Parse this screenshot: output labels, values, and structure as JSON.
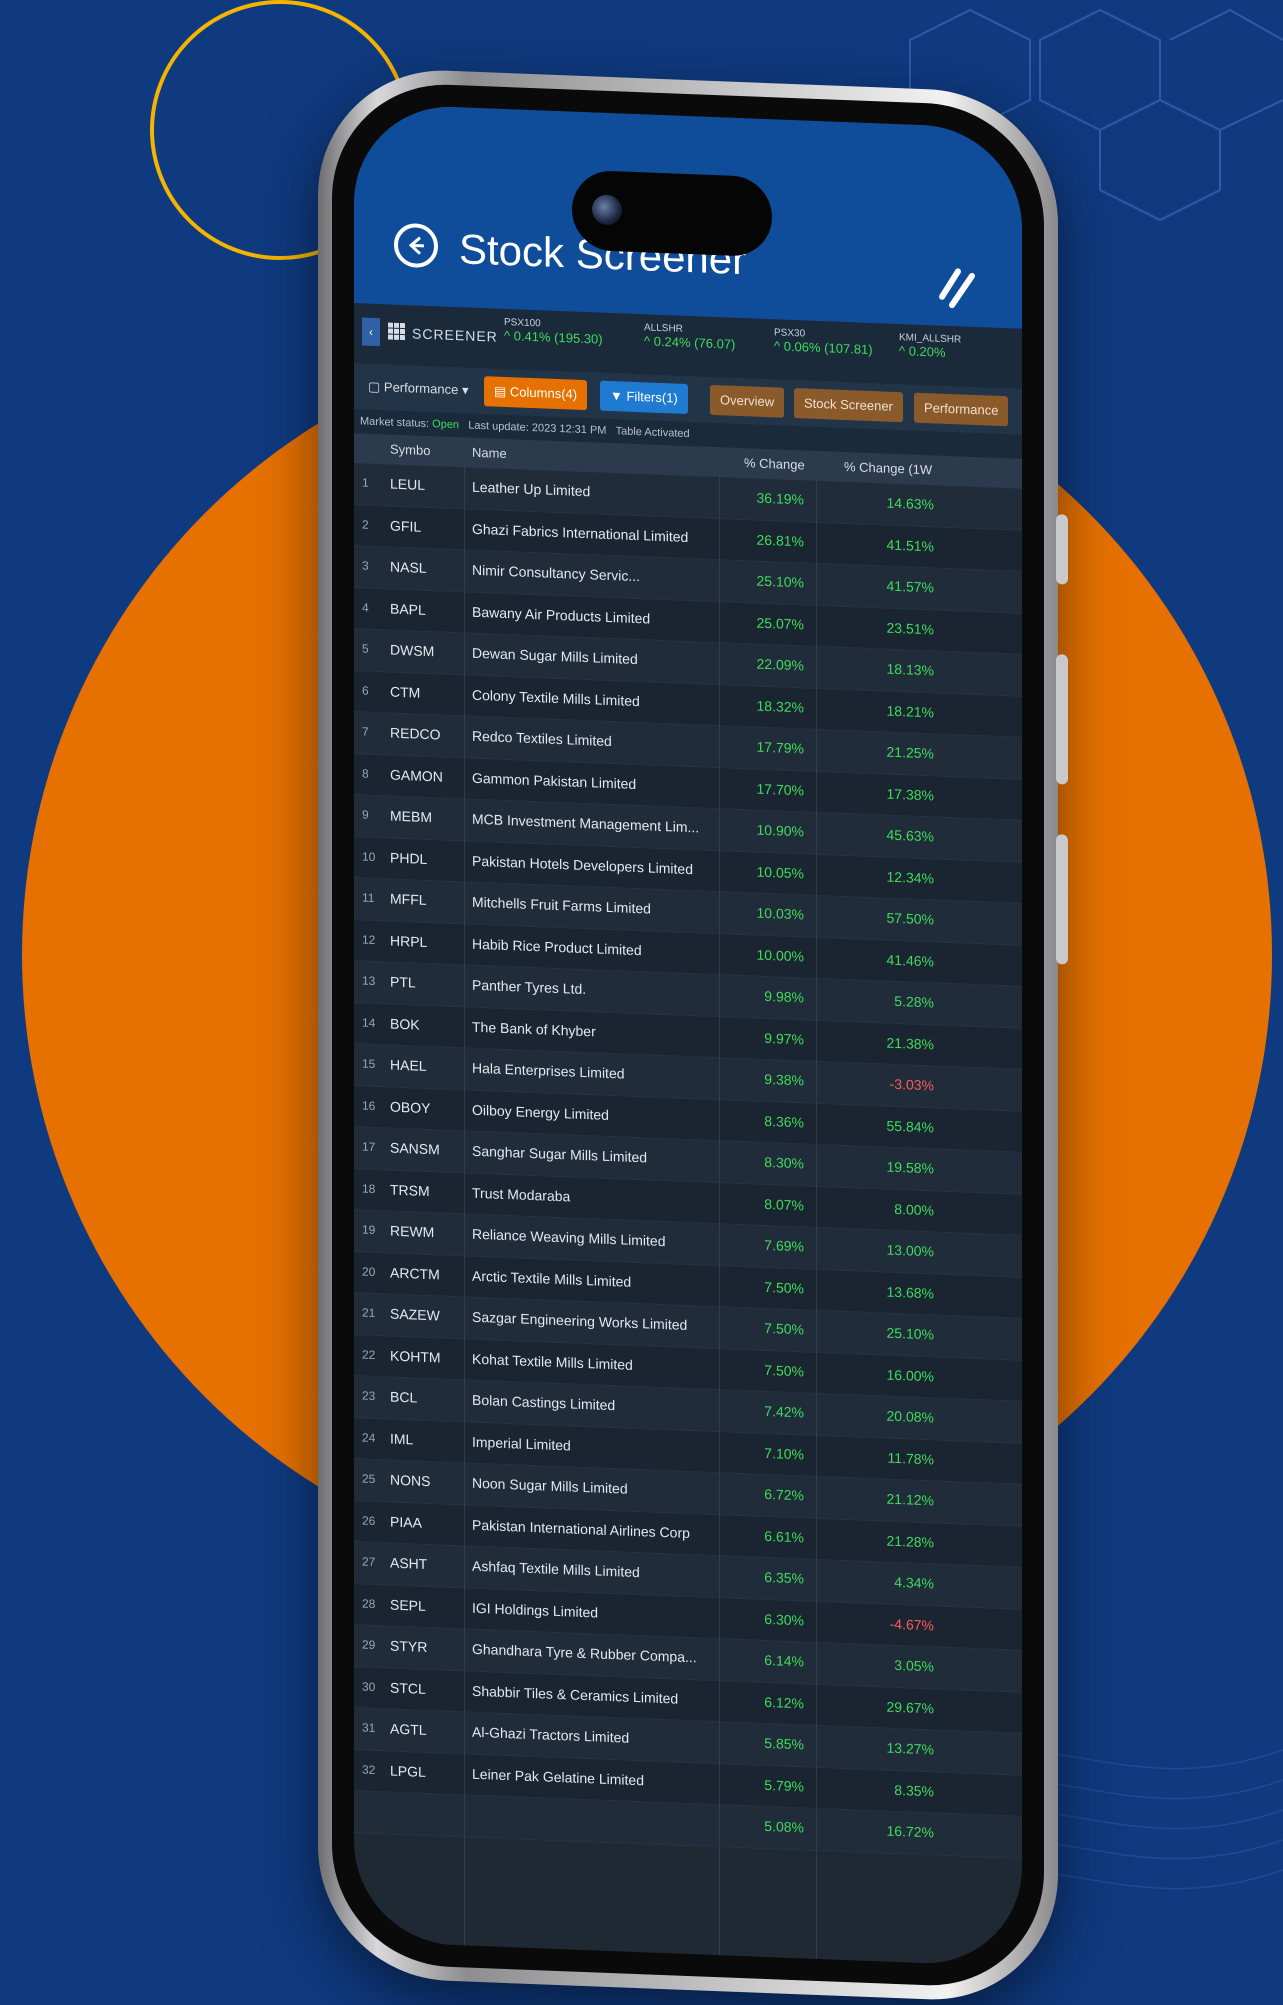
{
  "colors": {
    "background": "#0f3a80",
    "disc": "#e67100",
    "ring": "#f4b400",
    "positive": "#3fdc5b",
    "negative": "#ff5a5a"
  },
  "header": {
    "title": "Stock Screener",
    "back_icon": "back-arrow-icon",
    "logo_icon": "brand-slash-logo"
  },
  "toolbar": {
    "screener_label": "SCREENER",
    "tickers": [
      {
        "name": "PSX100",
        "change": "^ 0.41% (195.30)"
      },
      {
        "name": "ALLSHR",
        "change": "^ 0.24% (76.07)"
      },
      {
        "name": "PSX30",
        "change": "^ 0.06% (107.81)"
      },
      {
        "name": "KMI_ALLSHR",
        "change": "^ 0.20%"
      }
    ]
  },
  "filters": {
    "view_select": "Performance",
    "columns_button": "Columns(4)",
    "filters_button": "Filters(1)",
    "tabs": [
      "Overview",
      "Stock Screener",
      "Performance"
    ]
  },
  "status": {
    "market_label": "Market status:",
    "market_value": "Open",
    "last_update": "Last update: 2023 12:31 PM",
    "table_label": "Table Activated"
  },
  "table": {
    "headers": {
      "symbol": "Symbo",
      "name": "Name",
      "pct1": "% Change",
      "pct2": "% Change (1W"
    },
    "rows": [
      {
        "n": "1",
        "symbol": "LEUL",
        "name": "Leather Up Limited",
        "p1": "36.19%",
        "p2": "14.63%",
        "p2_sign": "pos"
      },
      {
        "n": "2",
        "symbol": "GFIL",
        "name": "Ghazi Fabrics International Limited",
        "p1": "26.81%",
        "p2": "41.51%",
        "p2_sign": "pos"
      },
      {
        "n": "3",
        "symbol": "NASL",
        "name": "Nimir Consultancy Servic...",
        "p1": "25.10%",
        "p2": "41.57%",
        "p2_sign": "pos"
      },
      {
        "n": "4",
        "symbol": "BAPL",
        "name": "Bawany Air Products Limited",
        "p1": "25.07%",
        "p2": "23.51%",
        "p2_sign": "pos"
      },
      {
        "n": "5",
        "symbol": "DWSM",
        "name": "Dewan Sugar Mills Limited",
        "p1": "22.09%",
        "p2": "18.13%",
        "p2_sign": "pos"
      },
      {
        "n": "6",
        "symbol": "CTM",
        "name": "Colony Textile Mills Limited",
        "p1": "18.32%",
        "p2": "18.21%",
        "p2_sign": "pos"
      },
      {
        "n": "7",
        "symbol": "REDCO",
        "name": "Redco Textiles Limited",
        "p1": "17.79%",
        "p2": "21.25%",
        "p2_sign": "pos"
      },
      {
        "n": "8",
        "symbol": "GAMON",
        "name": "Gammon Pakistan Limited",
        "p1": "17.70%",
        "p2": "17.38%",
        "p2_sign": "pos"
      },
      {
        "n": "9",
        "symbol": "MEBM",
        "name": "MCB Investment Management Lim...",
        "p1": "10.90%",
        "p2": "45.63%",
        "p2_sign": "pos"
      },
      {
        "n": "10",
        "symbol": "PHDL",
        "name": "Pakistan Hotels Developers Limited",
        "p1": "10.05%",
        "p2": "12.34%",
        "p2_sign": "pos"
      },
      {
        "n": "11",
        "symbol": "MFFL",
        "name": "Mitchells Fruit Farms Limited",
        "p1": "10.03%",
        "p2": "57.50%",
        "p2_sign": "pos"
      },
      {
        "n": "12",
        "symbol": "HRPL",
        "name": "Habib Rice Product Limited",
        "p1": "10.00%",
        "p2": "41.46%",
        "p2_sign": "pos"
      },
      {
        "n": "13",
        "symbol": "PTL",
        "name": "Panther Tyres Ltd.",
        "p1": "9.98%",
        "p2": "5.28%",
        "p2_sign": "pos"
      },
      {
        "n": "14",
        "symbol": "BOK",
        "name": "The Bank of Khyber",
        "p1": "9.97%",
        "p2": "21.38%",
        "p2_sign": "pos"
      },
      {
        "n": "15",
        "symbol": "HAEL",
        "name": "Hala Enterprises Limited",
        "p1": "9.38%",
        "p2": "-3.03%",
        "p2_sign": "neg"
      },
      {
        "n": "16",
        "symbol": "OBOY",
        "name": "Oilboy Energy Limited",
        "p1": "8.36%",
        "p2": "55.84%",
        "p2_sign": "pos"
      },
      {
        "n": "17",
        "symbol": "SANSM",
        "name": "Sanghar Sugar Mills Limited",
        "p1": "8.30%",
        "p2": "19.58%",
        "p2_sign": "pos"
      },
      {
        "n": "18",
        "symbol": "TRSM",
        "name": "Trust Modaraba",
        "p1": "8.07%",
        "p2": "8.00%",
        "p2_sign": "pos"
      },
      {
        "n": "19",
        "symbol": "REWM",
        "name": "Reliance Weaving Mills Limited",
        "p1": "7.69%",
        "p2": "13.00%",
        "p2_sign": "pos"
      },
      {
        "n": "20",
        "symbol": "ARCTM",
        "name": "Arctic Textile Mills Limited",
        "p1": "7.50%",
        "p2": "13.68%",
        "p2_sign": "pos"
      },
      {
        "n": "21",
        "symbol": "SAZEW",
        "name": "Sazgar Engineering Works Limited",
        "p1": "7.50%",
        "p2": "25.10%",
        "p2_sign": "pos"
      },
      {
        "n": "22",
        "symbol": "KOHTM",
        "name": "Kohat Textile Mills Limited",
        "p1": "7.50%",
        "p2": "16.00%",
        "p2_sign": "pos"
      },
      {
        "n": "23",
        "symbol": "BCL",
        "name": "Bolan Castings Limited",
        "p1": "7.42%",
        "p2": "20.08%",
        "p2_sign": "pos"
      },
      {
        "n": "24",
        "symbol": "IML",
        "name": "Imperial Limited",
        "p1": "7.10%",
        "p2": "11.78%",
        "p2_sign": "pos"
      },
      {
        "n": "25",
        "symbol": "NONS",
        "name": "Noon Sugar Mills Limited",
        "p1": "6.72%",
        "p2": "21.12%",
        "p2_sign": "pos"
      },
      {
        "n": "26",
        "symbol": "PIAA",
        "name": "Pakistan International Airlines Corp",
        "p1": "6.61%",
        "p2": "21.28%",
        "p2_sign": "pos"
      },
      {
        "n": "27",
        "symbol": "ASHT",
        "name": "Ashfaq Textile Mills Limited",
        "p1": "6.35%",
        "p2": "4.34%",
        "p2_sign": "pos"
      },
      {
        "n": "28",
        "symbol": "SEPL",
        "name": "IGI Holdings Limited",
        "p1": "6.30%",
        "p2": "-4.67%",
        "p2_sign": "neg"
      },
      {
        "n": "29",
        "symbol": "STYR",
        "name": "Ghandhara Tyre & Rubber Compa...",
        "p1": "6.14%",
        "p2": "3.05%",
        "p2_sign": "pos"
      },
      {
        "n": "30",
        "symbol": "STCL",
        "name": "Shabbir Tiles & Ceramics Limited",
        "p1": "6.12%",
        "p2": "29.67%",
        "p2_sign": "pos"
      },
      {
        "n": "31",
        "symbol": "AGTL",
        "name": "Al-Ghazi Tractors Limited",
        "p1": "5.85%",
        "p2": "13.27%",
        "p2_sign": "pos"
      },
      {
        "n": "32",
        "symbol": "LPGL",
        "name": "Leiner Pak Gelatine Limited",
        "p1": "5.79%",
        "p2": "8.35%",
        "p2_sign": "pos"
      },
      {
        "n": "",
        "symbol": "",
        "name": "",
        "p1": "5.08%",
        "p2": "16.72%",
        "p2_sign": "pos"
      }
    ]
  }
}
